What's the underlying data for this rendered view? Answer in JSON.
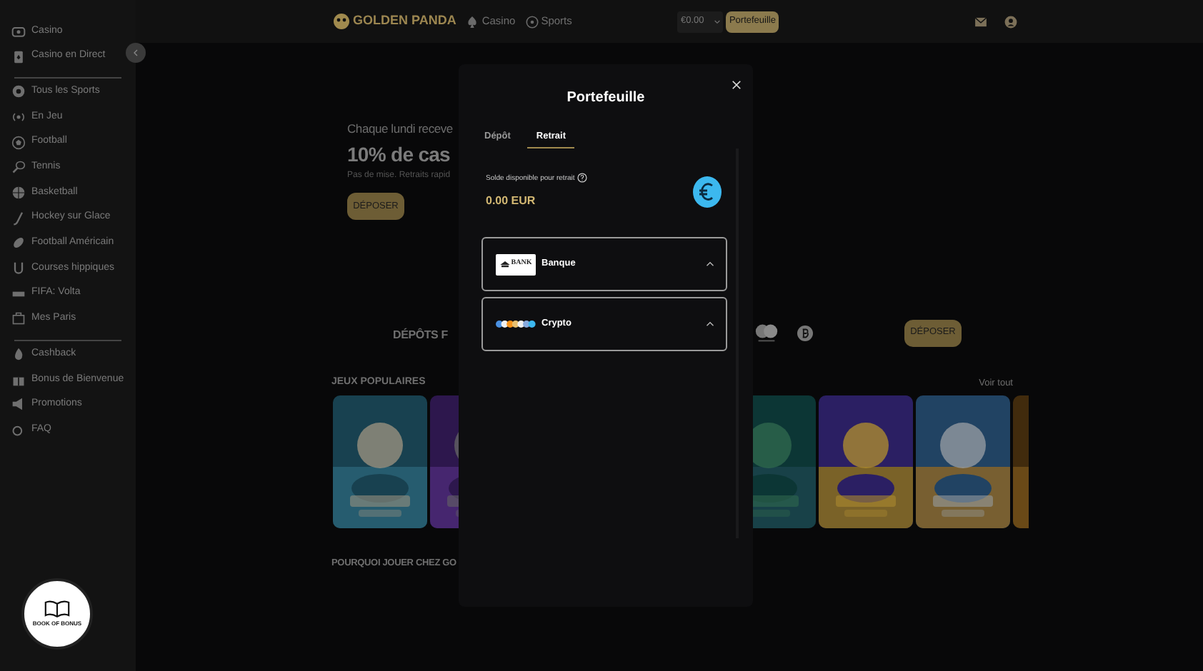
{
  "sidebar": {
    "groups": [
      {
        "items": [
          {
            "label": "Casino"
          },
          {
            "label": "Casino en Direct"
          }
        ]
      },
      {
        "items": [
          {
            "label": "Tous les Sports"
          },
          {
            "label": "En Jeu"
          },
          {
            "label": "Football"
          },
          {
            "label": "Tennis"
          },
          {
            "label": "Basketball"
          },
          {
            "label": "Hockey sur Glace"
          },
          {
            "label": "Football Américain"
          },
          {
            "label": "Courses hippiques"
          },
          {
            "label": "FIFA: Volta"
          },
          {
            "label": "Mes Paris"
          }
        ]
      },
      {
        "items": [
          {
            "label": "Cashback"
          },
          {
            "label": "Bonus de Bienvenue"
          },
          {
            "label": "Promotions"
          },
          {
            "label": "FAQ"
          }
        ]
      }
    ],
    "badge": {
      "text": "BOOK OF BONUS"
    }
  },
  "header": {
    "logo": "GOLDEN PANDA",
    "nav": [
      {
        "label": "Casino"
      },
      {
        "label": "Sports"
      }
    ],
    "balance": "€0.00",
    "wallet_button": "Portefeuille"
  },
  "hero": {
    "line": "Chaque lundi receve",
    "headline": "10% de cas",
    "subline": "Pas de mise. Retraits rapid",
    "button": "DÉPOSER"
  },
  "deposits": {
    "title": "DÉPÔTS F",
    "button": "DÉPOSER"
  },
  "popular": {
    "title": "JEUX POPULAIRES",
    "link": "Voir tout",
    "games": [
      {
        "kind": "picture"
      },
      {
        "kind": "picture"
      },
      {
        "kind": "hidden"
      },
      {
        "kind": "hidden"
      },
      {
        "kind": "picture"
      },
      {
        "kind": "picture"
      },
      {
        "kind": "picture"
      },
      {
        "kind": "picture"
      }
    ]
  },
  "why": {
    "title": "POURQUOI JOUER CHEZ GO"
  },
  "modal": {
    "title": "Portefeuille",
    "tabs": [
      {
        "label": "Dépôt",
        "selected": false
      },
      {
        "label": "Retrait",
        "selected": true
      }
    ],
    "balance_label": "Solde disponible pour retrait",
    "balance": "0.00 EUR",
    "methods": [
      {
        "kind": "bank",
        "logo_text": "BANK",
        "label": "Banque",
        "expanded": false
      },
      {
        "kind": "crypto",
        "label": "Crypto",
        "expanded": false
      }
    ]
  }
}
